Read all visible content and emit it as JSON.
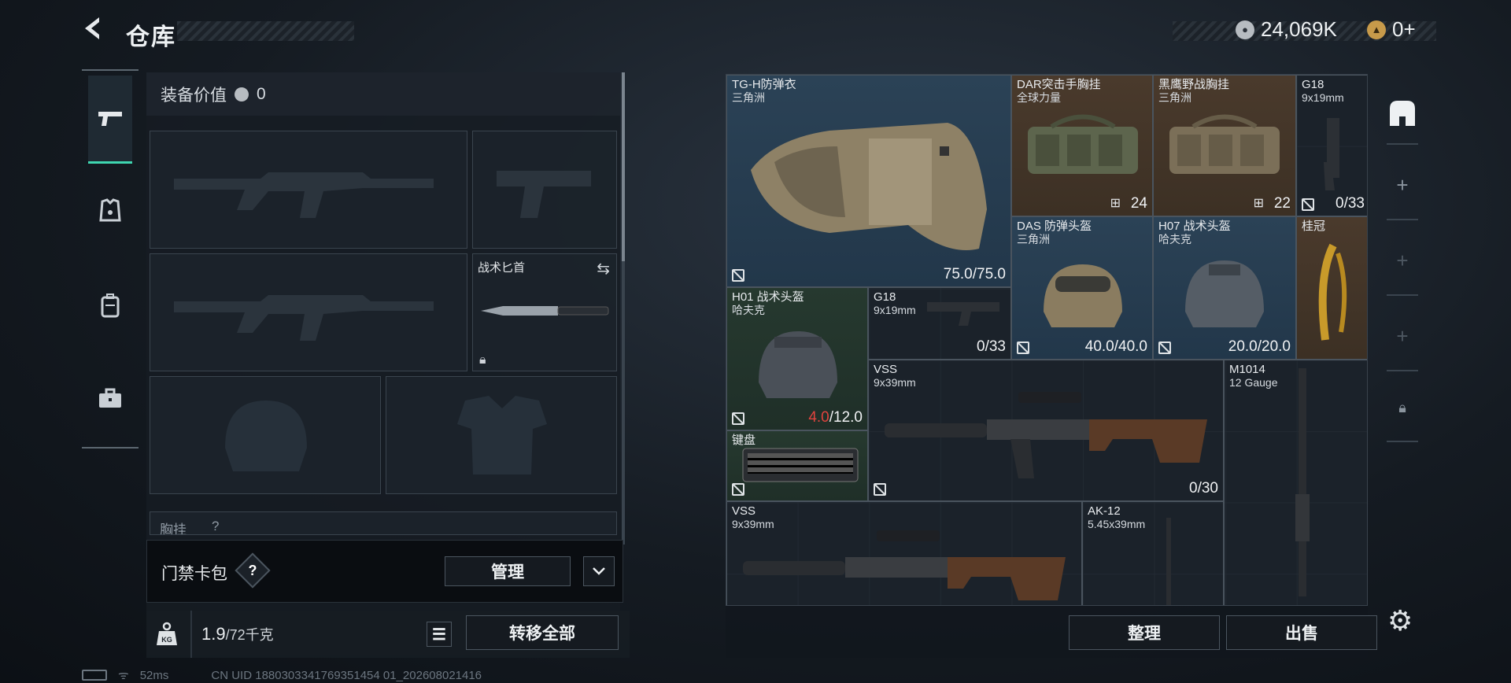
{
  "header": {
    "back_icon": "chevron-left-icon",
    "title": "仓库",
    "currency_primary": "24,069K",
    "currency_secondary": "0+"
  },
  "nav": {
    "items": [
      {
        "icon": "pistol-icon",
        "active": true
      },
      {
        "icon": "armor-icon",
        "active": false
      },
      {
        "icon": "backpack-icon",
        "active": false
      },
      {
        "icon": "toolbox-icon",
        "active": false
      }
    ]
  },
  "equipment": {
    "value_label": "装备价值",
    "value": "0",
    "melee_label": "战术匕首",
    "chest_rig_label": "胸挂",
    "chest_rig_mark": "?"
  },
  "card_bag": {
    "label": "门禁卡包",
    "help": "?",
    "manage_button": "管理"
  },
  "footer_left": {
    "weight_current": "1.9",
    "weight_max": "/72千克",
    "transfer_all_button": "转移全部"
  },
  "status_bar": {
    "ping": "52ms",
    "uid": "CN UID 1880303341769351454 01_202608021416"
  },
  "stash": {
    "items": [
      {
        "name": "TG-H防弹衣",
        "sub": "三角洲",
        "stat": "75.0/75.0",
        "stat_prefix": "",
        "bg": "blue",
        "no_insure": true
      },
      {
        "name": "DAR突击手胸挂",
        "sub": "全球力量",
        "stat": "24",
        "stat_prefix": "",
        "bg": "brown",
        "no_insure": false
      },
      {
        "name": "黑鹰野战胸挂",
        "sub": "三角洲",
        "stat": "22",
        "stat_prefix": "",
        "bg": "brown",
        "no_insure": false
      },
      {
        "name": "G18",
        "sub": "9x19mm",
        "stat": "0/33",
        "stat_prefix": "",
        "bg": "dark",
        "no_insure": true
      },
      {
        "name": "DAS 防弹头盔",
        "sub": "三角洲",
        "stat": "40.0/40.0",
        "stat_prefix": "",
        "bg": "blue",
        "no_insure": true
      },
      {
        "name": "H07 战术头盔",
        "sub": "哈夫克",
        "stat": "20.0/20.0",
        "stat_prefix": "",
        "bg": "blue",
        "no_insure": true
      },
      {
        "name": "桂冠",
        "sub": "",
        "stat": "",
        "stat_prefix": "",
        "bg": "brown",
        "no_insure": false
      },
      {
        "name": "H01 战术头盔",
        "sub": "哈夫克",
        "stat": "/12.0",
        "stat_prefix": "4.0",
        "bg": "green",
        "no_insure": true
      },
      {
        "name": "G18",
        "sub": "9x19mm",
        "stat": "0/33",
        "stat_prefix": "",
        "bg": "dark",
        "no_insure": false
      },
      {
        "name": "VSS",
        "sub": "9x39mm",
        "stat": "0/30",
        "stat_prefix": "",
        "bg": "dark",
        "no_insure": false
      },
      {
        "name": "M1014",
        "sub": "12 Gauge",
        "stat": "",
        "stat_prefix": "",
        "bg": "dark",
        "no_insure": false
      },
      {
        "name": "键盘",
        "sub": "",
        "stat": "",
        "stat_prefix": "",
        "bg": "green",
        "no_insure": true
      },
      {
        "name": "VSS",
        "sub": "9x39mm",
        "stat": "",
        "stat_prefix": "",
        "bg": "dark",
        "no_insure": false
      },
      {
        "name": "AK-12",
        "sub": "5.45x39mm",
        "stat": "",
        "stat_prefix": "",
        "bg": "dark",
        "no_insure": false
      }
    ]
  },
  "footer_right": {
    "sort_button": "整理",
    "sell_button": "出售"
  },
  "colors": {
    "accent": "#3fd6b0",
    "durability_low": "#e0433e"
  }
}
